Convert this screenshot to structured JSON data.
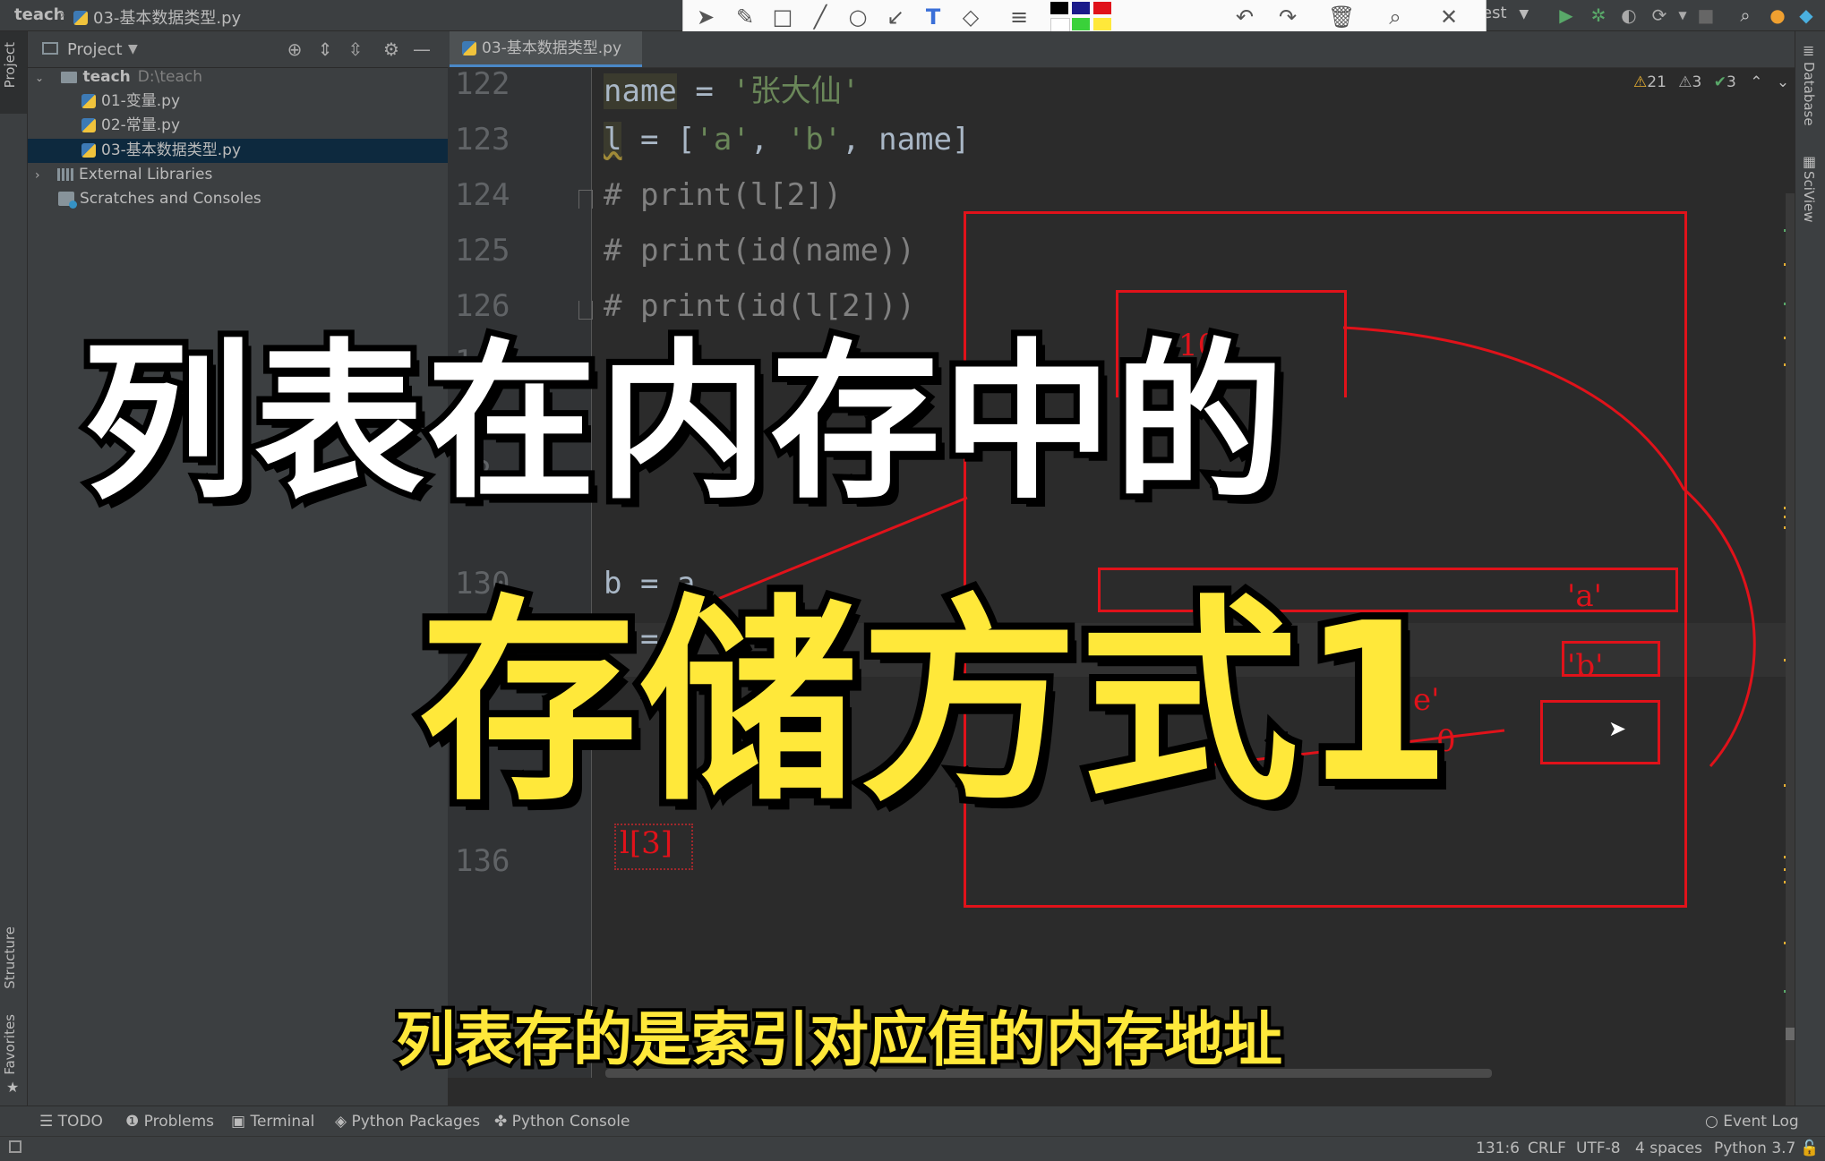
{
  "breadcrumb": {
    "project": "teach",
    "file": "03-基本数据类型.py"
  },
  "run_config": {
    "label": "test"
  },
  "project_panel": {
    "title": "Project",
    "tree": [
      {
        "label": "teach",
        "hint": "D:\\teach",
        "kind": "folder",
        "expanded": true
      },
      {
        "label": "01-变量.py",
        "kind": "py"
      },
      {
        "label": "02-常量.py",
        "kind": "py"
      },
      {
        "label": "03-基本数据类型.py",
        "kind": "py",
        "selected": true
      },
      {
        "label": "External Libraries",
        "kind": "lib"
      },
      {
        "label": "Scratches and Consoles",
        "kind": "scratch"
      }
    ]
  },
  "editor": {
    "tab": "03-基本数据类型.py",
    "inspections": {
      "warnings": "21",
      "weak": "3",
      "ok": "3"
    },
    "lines": [
      {
        "num": "122",
        "code": "name = '张大仙'"
      },
      {
        "num": "123",
        "code": "l = ['a', 'b', name]"
      },
      {
        "num": "124",
        "code": "# print(l[2])"
      },
      {
        "num": "125",
        "code": "# print(id(name))"
      },
      {
        "num": "126",
        "code": "# print(id(l[2]))"
      },
      {
        "num": "1",
        "code": ""
      },
      {
        "num": "12",
        "code": ""
      },
      {
        "num": "130",
        "code": "b = a"
      },
      {
        "num": "131",
        "code": "  = a"
      },
      {
        "num": "136",
        "code": ""
      }
    ],
    "diagram": {
      "box_top_label": "100",
      "item_a": "'a'",
      "item_b": "'b'",
      "index_label": "l[3]",
      "obscured_1": "e'",
      "obscured_2": "0"
    }
  },
  "left_strip": {
    "project": "Project",
    "structure": "Structure",
    "favorites": "Favorites"
  },
  "right_strip": {
    "database": "Database",
    "sciview": "SciView"
  },
  "bottom_tools": [
    "TODO",
    "Problems",
    "Terminal",
    "Python Packages",
    "Python Console"
  ],
  "event_log": "Event Log",
  "status": {
    "pos": "131:6",
    "eol": "CRLF",
    "enc": "UTF-8",
    "indent": "4 spaces",
    "interp": "Python 3.7"
  },
  "overlay": {
    "line1": "列表在内存中的",
    "line2": "存储方式1",
    "subtitle": "列表存的是索引对应值的内存地址"
  },
  "colors": {
    "accent_yellow": "#ffe83a",
    "diagram_red": "#e0121a",
    "selection": "#0d293e"
  }
}
